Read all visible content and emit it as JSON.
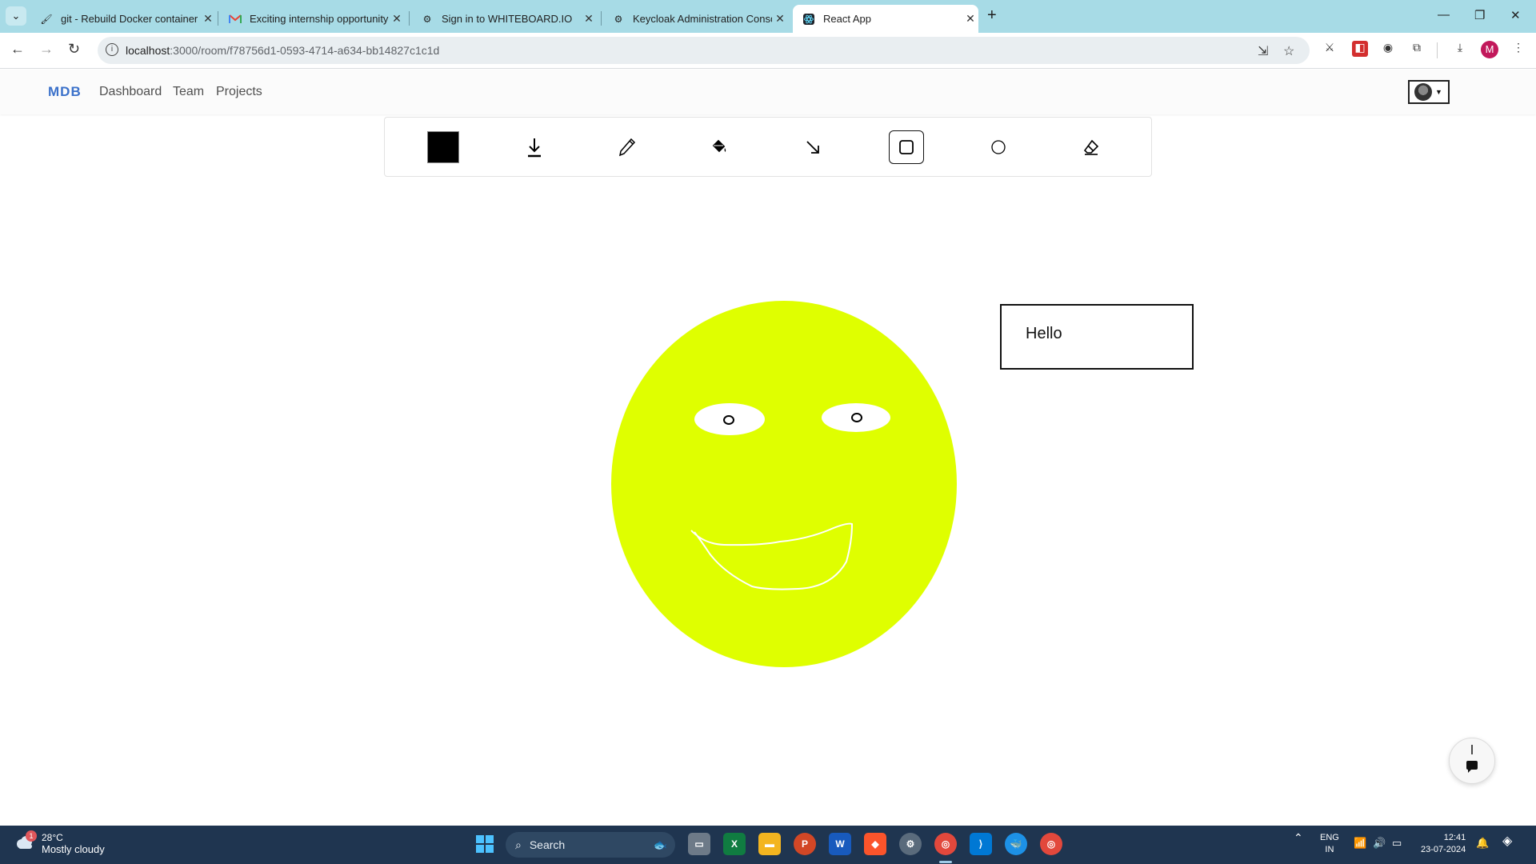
{
  "browser": {
    "tabs": [
      {
        "title": "git - Rebuild Docker container o",
        "active": false
      },
      {
        "title": "Exciting internship opportunity",
        "active": false
      },
      {
        "title": "Sign in to WHITEBOARD.IO",
        "active": false
      },
      {
        "title": "Keycloak Administration Conso",
        "active": false
      },
      {
        "title": "React App",
        "active": true
      }
    ],
    "url_host": "localhost",
    "url_path": ":3000/room/f78756d1-0593-4714-a634-bb14827c1c1d",
    "profile_initial": "M"
  },
  "app": {
    "logo": "MDB",
    "nav": [
      "Dashboard",
      "Team",
      "Projects"
    ]
  },
  "tools": {
    "current_color": "#000000",
    "items": [
      "color-picker",
      "download",
      "pencil",
      "fill-bucket",
      "arrow",
      "rectangle",
      "circle",
      "eraser"
    ],
    "selected": "rectangle"
  },
  "canvas": {
    "text_box": "Hello",
    "face_color": "#dfff00"
  },
  "taskbar": {
    "weather_temp": "28°C",
    "weather_desc": "Mostly cloudy",
    "weather_badge": "1",
    "search_placeholder": "Search",
    "lang_top": "ENG",
    "lang_bottom": "IN",
    "time": "12:41",
    "date": "23-07-2024"
  }
}
